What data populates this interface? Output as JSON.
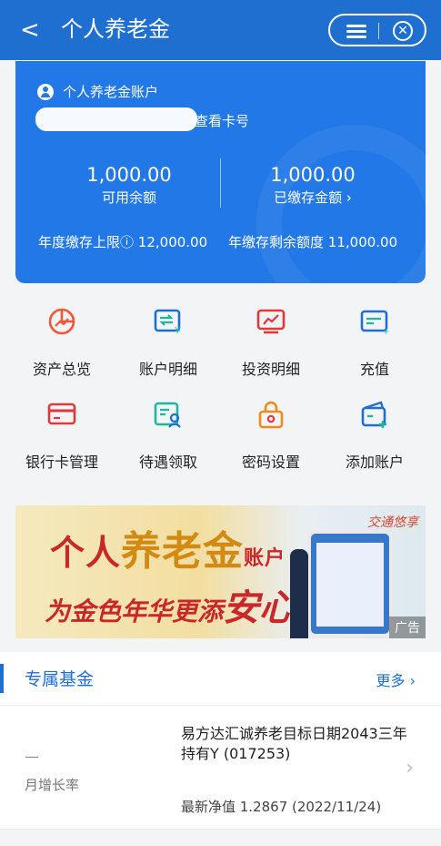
{
  "header": {
    "back": "<",
    "title": "个人养老金"
  },
  "account": {
    "title": "个人养老金账户",
    "view_card": "查看卡号",
    "available_amount": "1,000.00",
    "available_label": "可用余额",
    "paid_amount": "1,000.00",
    "paid_label": "已缴存金额 ›",
    "limit_label": "年度缴存上限ⓘ",
    "limit_value": "12,000.00",
    "remain_label": "年缴存剩余额度",
    "remain_value": "11,000.00"
  },
  "grid": [
    {
      "label": "资产总览",
      "icon": "pie-chart-icon"
    },
    {
      "label": "账户明细",
      "icon": "transfer-detail-icon"
    },
    {
      "label": "投资明细",
      "icon": "investment-chart-icon"
    },
    {
      "label": "充值",
      "icon": "recharge-card-icon"
    },
    {
      "label": "银行卡管理",
      "icon": "bank-card-icon"
    },
    {
      "label": "待遇领取",
      "icon": "benefit-receive-icon"
    },
    {
      "label": "密码设置",
      "icon": "password-lock-icon"
    },
    {
      "label": "添加账户",
      "icon": "add-wallet-icon"
    }
  ],
  "banner": {
    "line1a": "个人",
    "line1b": "养老金",
    "line1c": "账户",
    "line2a": "为金色年华更添",
    "line2b": "安心",
    "logo": "交通悠享",
    "ad": "广告"
  },
  "fund_section": {
    "title": "专属基金",
    "more": "更多 ›"
  },
  "fund": {
    "rate_value": "—",
    "rate_label": "月增长率",
    "name": "易方达汇诚养老目标日期2043三年持有Y (017253)",
    "nav": "最新净值 1.2867 (2022/11/24)"
  },
  "colors": {
    "brand": "#1f6fd1",
    "card": "#2378e8",
    "icon_orange": "#f0563a"
  }
}
